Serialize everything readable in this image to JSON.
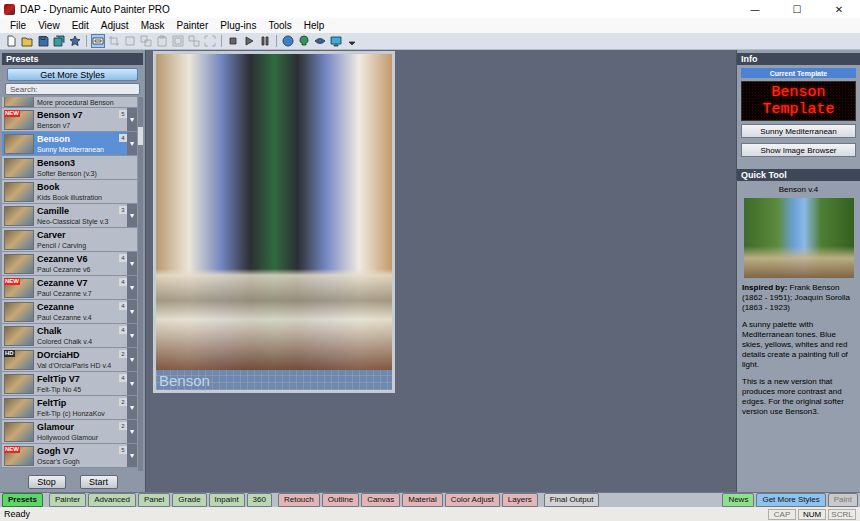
{
  "window": {
    "title": "DAP - Dynamic Auto Painter PRO",
    "controls": [
      "—",
      "☐",
      "✕"
    ]
  },
  "menu": [
    "File",
    "View",
    "Edit",
    "Adjust",
    "Mask",
    "Painter",
    "Plug-ins",
    "Tools",
    "Help"
  ],
  "toolbar": [
    {
      "selected": false,
      "disabled": false
    },
    {
      "selected": false,
      "disabled": false
    },
    {
      "selected": false,
      "disabled": false
    },
    {
      "selected": false,
      "disabled": false
    },
    {
      "selected": false,
      "disabled": false
    },
    {
      "selected": true,
      "disabled": false
    },
    {
      "selected": false,
      "disabled": true
    },
    {
      "selected": false,
      "disabled": true
    },
    {
      "selected": false,
      "disabled": true
    },
    {
      "selected": false,
      "disabled": true
    },
    {
      "selected": false,
      "disabled": true
    },
    {
      "selected": false,
      "disabled": true
    },
    {
      "selected": false,
      "disabled": true
    },
    {
      "selected": false,
      "disabled": false
    },
    {
      "selected": false,
      "disabled": false
    },
    {
      "selected": false,
      "disabled": false
    },
    {
      "selected": false,
      "disabled": false
    },
    {
      "selected": false,
      "disabled": false
    },
    {
      "selected": false,
      "disabled": false
    },
    {
      "selected": false,
      "disabled": false
    },
    {
      "selected": false,
      "disabled": false
    }
  ],
  "presets": {
    "title": "Presets",
    "get_more_button": "Get More Styles",
    "search_placeholder": "Search:",
    "scroll_level": 0.08,
    "items": [
      {
        "kind": "partial",
        "subtitle": "More procedural Benson",
        "selected": false
      },
      {
        "kind": "preset",
        "name": "Benson v7",
        "subtitle": "Benson v7",
        "badge": {
          "text": "NEW",
          "color": "#e8261e"
        },
        "number": "5",
        "arrow": "▾",
        "selected": false
      },
      {
        "kind": "preset",
        "name": "Benson",
        "subtitle": "Sunny Mediterranean",
        "number": "4",
        "arrow": "▾",
        "selected": true
      },
      {
        "kind": "preset",
        "name": "Benson3",
        "subtitle": "Softer Benson (v.3)",
        "selected": false
      },
      {
        "kind": "preset",
        "name": "Book",
        "subtitle": "Kids Book illustration",
        "selected": false
      },
      {
        "kind": "preset",
        "name": "Camille",
        "subtitle": "Neo-Classical Style v.3",
        "number": "3",
        "arrow": "▾",
        "selected": false
      },
      {
        "kind": "preset",
        "name": "Carver",
        "subtitle": "Pencil / Carving",
        "selected": false
      },
      {
        "kind": "preset",
        "name": "Cezanne V6",
        "subtitle": "Paul Cezanne v6",
        "number": "4",
        "arrow": "▾",
        "selected": false
      },
      {
        "kind": "preset",
        "name": "Cezanne V7",
        "subtitle": "Paul Cezanne v.7",
        "badge": {
          "text": "NEW",
          "color": "#e8261e"
        },
        "number": "4",
        "arrow": "▾",
        "selected": false
      },
      {
        "kind": "preset",
        "name": "Cezanne",
        "subtitle": "Paul Cezanne v.4",
        "number": "4",
        "arrow": "▾",
        "selected": false
      },
      {
        "kind": "preset",
        "name": "Chalk",
        "subtitle": "Colored Chalk v.4",
        "number": "4",
        "arrow": "▾",
        "selected": false
      },
      {
        "kind": "preset",
        "name": "DOrciaHD",
        "subtitle": "Val d'Orcia/Paris HD v.4",
        "badge": {
          "text": "HD",
          "color": "#2a2a2a"
        },
        "number": "2",
        "arrow": "▾",
        "selected": false
      },
      {
        "kind": "preset",
        "name": "FeltTip V7",
        "subtitle": "Felt-Tip No 45",
        "number": "4",
        "arrow": "▾",
        "selected": false
      },
      {
        "kind": "preset",
        "name": "FeltTip",
        "subtitle": "Felt-Tip (c) HonzaKov",
        "number": "2",
        "arrow": "▾",
        "selected": false
      },
      {
        "kind": "preset",
        "name": "Glamour",
        "subtitle": "Hollywood Glamour",
        "number": "2",
        "arrow": "▾",
        "selected": false
      },
      {
        "kind": "preset",
        "name": "Gogh V7",
        "subtitle": "Oscar's Gogh",
        "badge": {
          "text": "NEW",
          "color": "#e8261e"
        },
        "number": "5",
        "arrow": "▾",
        "selected": false
      }
    ],
    "buttons": [
      "Stop",
      "Start"
    ]
  },
  "canvas": {
    "caption": "Benson"
  },
  "info": {
    "title": "Info",
    "current_template_label": "Current Template",
    "led_lines": [
      "Benson",
      "Template"
    ],
    "buttons": [
      "Sunny Mediterranean",
      "Show Image Browser"
    ]
  },
  "quick_tool": {
    "title": "Quick Tool",
    "preset_name": "Benson v.4",
    "inspired_label": "Inspired by:",
    "inspired_text": "Frank Benson (1862 - 1951); Joaquín Sorolla (1863 - 1923)",
    "paragraphs": [
      "A sunny palette with Mediterranean tones. Blue skies, yellows, whites and red details create a painting full of light.",
      "This is a new version that produces more contrast and edges. For the original softer version use Benson3."
    ]
  },
  "bottom_tabs": {
    "left": [
      {
        "label": "Presets",
        "selected": true,
        "disabled": false,
        "color": "#5fd46a"
      },
      {
        "label": "Painter",
        "selected": false,
        "disabled": false,
        "color": "#b9d7b3"
      },
      {
        "label": "Advanced",
        "selected": false,
        "disabled": false,
        "color": "#b9d7b3"
      },
      {
        "label": "Panel",
        "selected": false,
        "disabled": false,
        "color": "#b9d7b3"
      },
      {
        "label": "Grade",
        "selected": false,
        "disabled": false,
        "color": "#b9d7b3"
      },
      {
        "label": "Inpaint",
        "selected": false,
        "disabled": false,
        "color": "#b9d7b3"
      },
      {
        "label": "360",
        "selected": false,
        "disabled": false,
        "color": "#b9d7b3"
      },
      {
        "label": "Retouch",
        "selected": false,
        "disabled": false,
        "color": "#e2b6b6"
      },
      {
        "label": "Outline",
        "selected": false,
        "disabled": false,
        "color": "#e2b6b6"
      },
      {
        "label": "Canvas",
        "selected": false,
        "disabled": false,
        "color": "#e2b6b6"
      },
      {
        "label": "Material",
        "selected": false,
        "disabled": false,
        "color": "#e2b6b6"
      },
      {
        "label": "Color Adjust",
        "selected": false,
        "disabled": false,
        "color": "#e2b6b6"
      },
      {
        "label": "Layers",
        "selected": false,
        "disabled": false,
        "color": "#e2b6b6"
      },
      {
        "label": "Final Output",
        "selected": false,
        "disabled": false,
        "color": "#d2d2d2"
      }
    ],
    "right": [
      {
        "label": "News",
        "selected": false,
        "disabled": false,
        "color": "#8ee08e"
      },
      {
        "label": "Get More Styles",
        "selected": false,
        "disabled": false,
        "color": "#8ec3ee"
      },
      {
        "label": "Paint",
        "selected": false,
        "disabled": true,
        "color": "#c9c9c9"
      }
    ]
  },
  "status_bar": {
    "text": "Ready",
    "indicators": [
      {
        "label": "CAP",
        "on": false
      },
      {
        "label": "NUM",
        "on": true
      },
      {
        "label": "SCRL",
        "on": false
      }
    ]
  }
}
